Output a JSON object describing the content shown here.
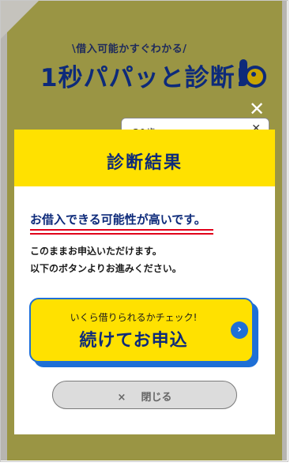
{
  "background_page": {
    "tagline": "\\借入可能かすぐわかる/",
    "brand_title": "1秒パパッと診断!",
    "age_label": "ご年齢",
    "age_select_value": "30歳",
    "age_select_chevron": "✕",
    "overlay_close": "✕"
  },
  "modal": {
    "title": "診断結果",
    "result_heading": "お借入できる可能性が高いです。",
    "result_lines": [
      "このままお申込いただけます。",
      "以下のボタンよりお進みください。"
    ],
    "cta": {
      "sub_label": "いくら借りられるかチェック!",
      "main_label": "続けてお申込",
      "arrow": "›"
    },
    "close_button": {
      "icon": "×",
      "label": "閉じる"
    }
  },
  "colors": {
    "accent_yellow": "#ffe100",
    "brand_navy": "#0d2a7a",
    "cta_blue": "#1e6fd6",
    "underline_red": "#e1001a",
    "overlay_olive": "#9a9544"
  }
}
